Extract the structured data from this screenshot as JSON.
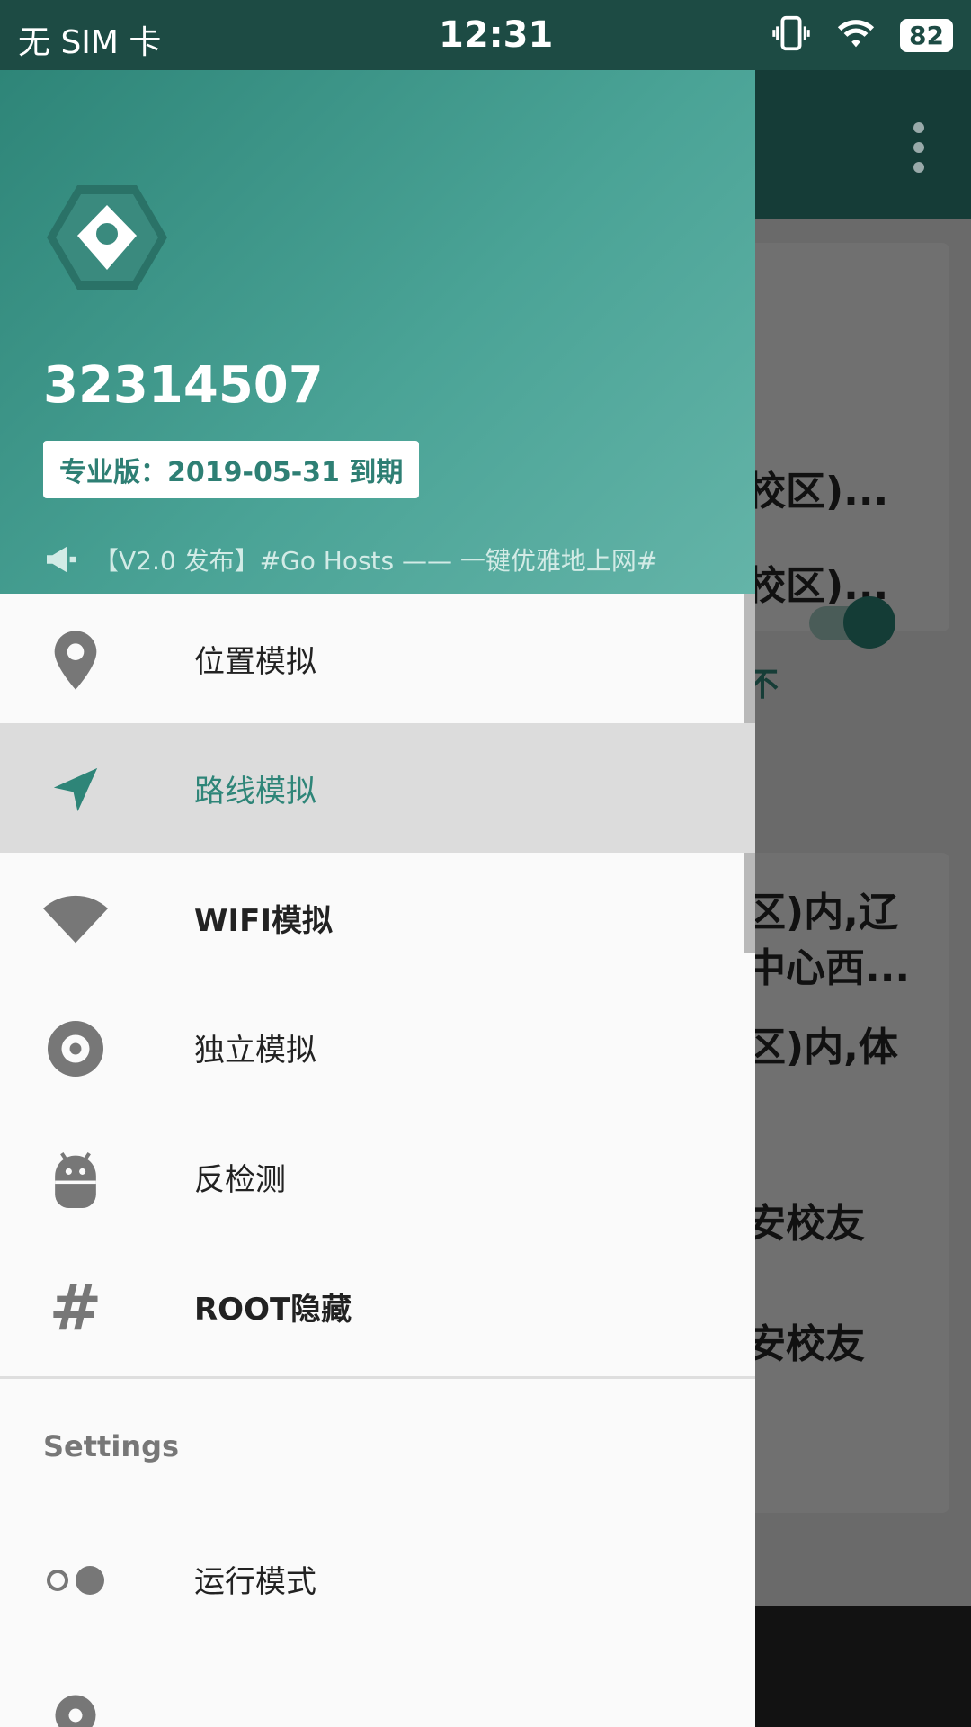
{
  "status": {
    "carrier": "无 SIM 卡",
    "time": "12:31",
    "battery": "82",
    "icons": [
      "vibrate-icon",
      "wifi-icon",
      "battery-icon"
    ]
  },
  "background": {
    "card1_lines": [
      "校区)...",
      "校区)...",
      "不"
    ],
    "card2_lines": [
      "区)内,辽",
      "中心西...",
      "区)内,体",
      "安校友",
      "安校友"
    ]
  },
  "drawer": {
    "user_id": "32314507",
    "pro_badge": "专业版：2019-05-31 到期",
    "announcement": "【V2.0 发布】#Go Hosts —— 一键优雅地上网#",
    "menu": [
      {
        "label": "位置模拟",
        "icon": "location-pin-icon"
      },
      {
        "label": "路线模拟",
        "icon": "navigation-arrow-icon",
        "active": true
      },
      {
        "label": "WIFI模拟",
        "icon": "wifi-icon"
      },
      {
        "label": "独立模拟",
        "icon": "disc-icon"
      },
      {
        "label": "反检测",
        "icon": "android-icon"
      },
      {
        "label": "ROOT隐藏",
        "icon": "hash-icon"
      }
    ],
    "settings_title": "Settings",
    "settings_items": [
      {
        "label": "运行模式",
        "icon": "toggle-dots-icon"
      }
    ]
  },
  "colors": {
    "accent": "#2e8578",
    "status_bar": "#1d4b44"
  }
}
